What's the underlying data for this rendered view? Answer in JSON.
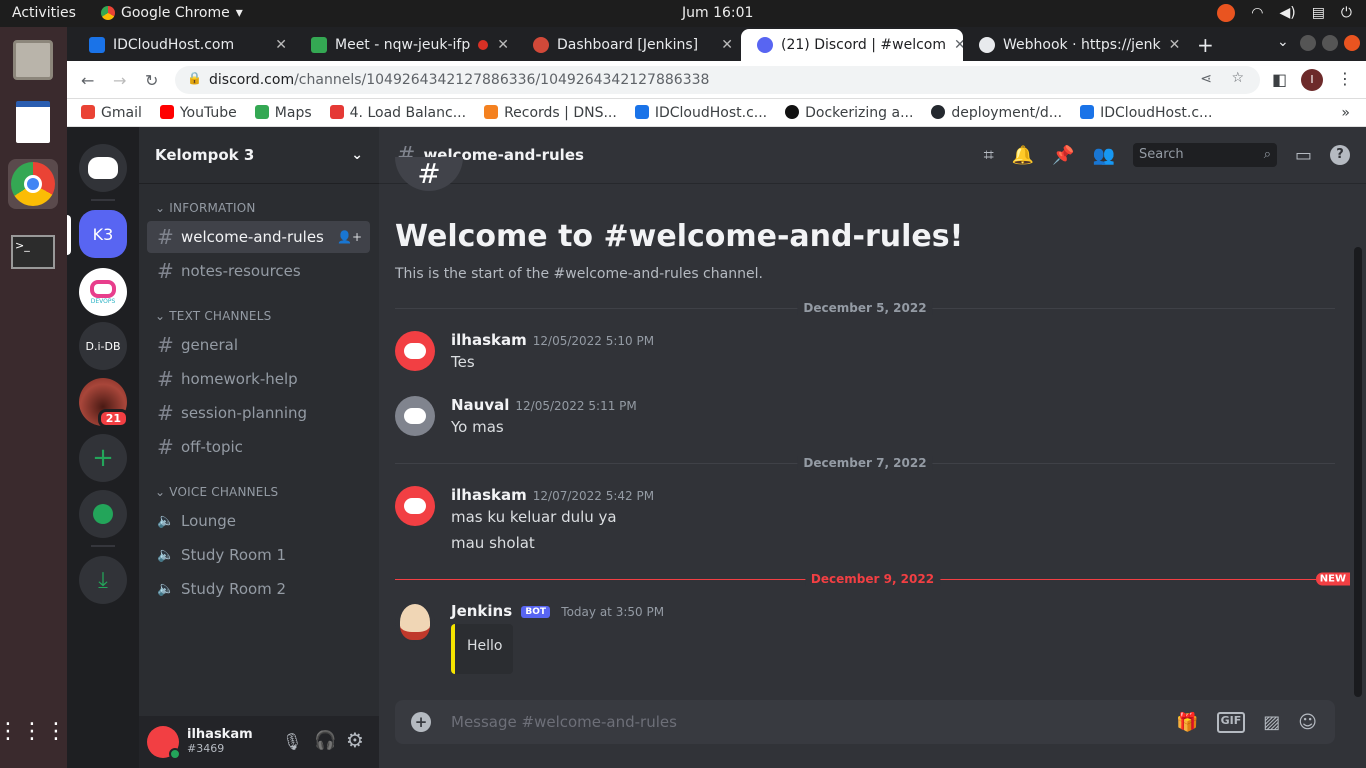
{
  "os": {
    "activities": "Activities",
    "app_name": "Google Chrome",
    "clock": "Jum 16:01"
  },
  "browser": {
    "tabs": [
      {
        "title": "IDCloudHost.com",
        "color": "#1a73e8"
      },
      {
        "title": "Meet - nqw-jeuk-ifp",
        "color": "#34a853"
      },
      {
        "title": "Dashboard [Jenkins]",
        "color": "#d24939"
      },
      {
        "title": "(21) Discord | #welcom",
        "color": "#5865f2"
      },
      {
        "title": "Webhook · https://jenk",
        "color": "#24292f"
      }
    ],
    "url_host": "discord.com",
    "url_path": "/channels/1049264342127886336/1049264342127886338",
    "bookmarks": [
      {
        "label": "Gmail",
        "color": "#ea4335"
      },
      {
        "label": "YouTube",
        "color": "#ff0000"
      },
      {
        "label": "Maps",
        "color": "#34a853"
      },
      {
        "label": "4. Load Balanc...",
        "color": "#e53935"
      },
      {
        "label": "Records | DNS...",
        "color": "#f48120"
      },
      {
        "label": "IDCloudHost.c...",
        "color": "#1a73e8"
      },
      {
        "label": "Dockerizing a...",
        "color": "#111111"
      },
      {
        "label": "deployment/d...",
        "color": "#24292f"
      },
      {
        "label": "IDCloudHost.c...",
        "color": "#1a73e8"
      }
    ]
  },
  "guilds": {
    "k3": "K3",
    "didb": "D.i-DB",
    "badge": "21",
    "devops": "DEVOPS"
  },
  "server": {
    "name": "Kelompok 3",
    "categories": {
      "info": "INFORMATION",
      "text": "TEXT CHANNELS",
      "voice": "VOICE CHANNELS"
    },
    "info_channels": [
      "welcome-and-rules",
      "notes-resources"
    ],
    "text_channels": [
      "general",
      "homework-help",
      "session-planning",
      "off-topic"
    ],
    "voice_channels": [
      "Lounge",
      "Study Room 1",
      "Study Room 2"
    ]
  },
  "user": {
    "name": "ilhaskam",
    "tag": "#3469"
  },
  "chat": {
    "channel": "welcome-and-rules",
    "search_placeholder": "Search",
    "welcome_title": "Welcome to #welcome-and-rules!",
    "welcome_sub": "This is the start of the #welcome-and-rules channel.",
    "dividers": [
      "December 5, 2022",
      "December 7, 2022",
      "December 9, 2022"
    ],
    "new_label": "NEW",
    "messages": [
      {
        "author": "ilhaskam",
        "time": "12/05/2022 5:10 PM",
        "lines": [
          "Tes"
        ]
      },
      {
        "author": "Nauval",
        "time": "12/05/2022 5:11 PM",
        "lines": [
          "Yo mas"
        ]
      },
      {
        "author": "ilhaskam",
        "time": "12/07/2022 5:42 PM",
        "lines": [
          "mas ku keluar dulu ya",
          "mau sholat"
        ]
      },
      {
        "author": "Jenkins",
        "bot_label": "BOT",
        "time": "Today at 3:50 PM",
        "embed": "Hello"
      }
    ],
    "composer_placeholder": "Message #welcome-and-rules"
  },
  "colors": {
    "accent": "#5865f2",
    "new_red": "#f23f43",
    "online": "#23a55a"
  }
}
